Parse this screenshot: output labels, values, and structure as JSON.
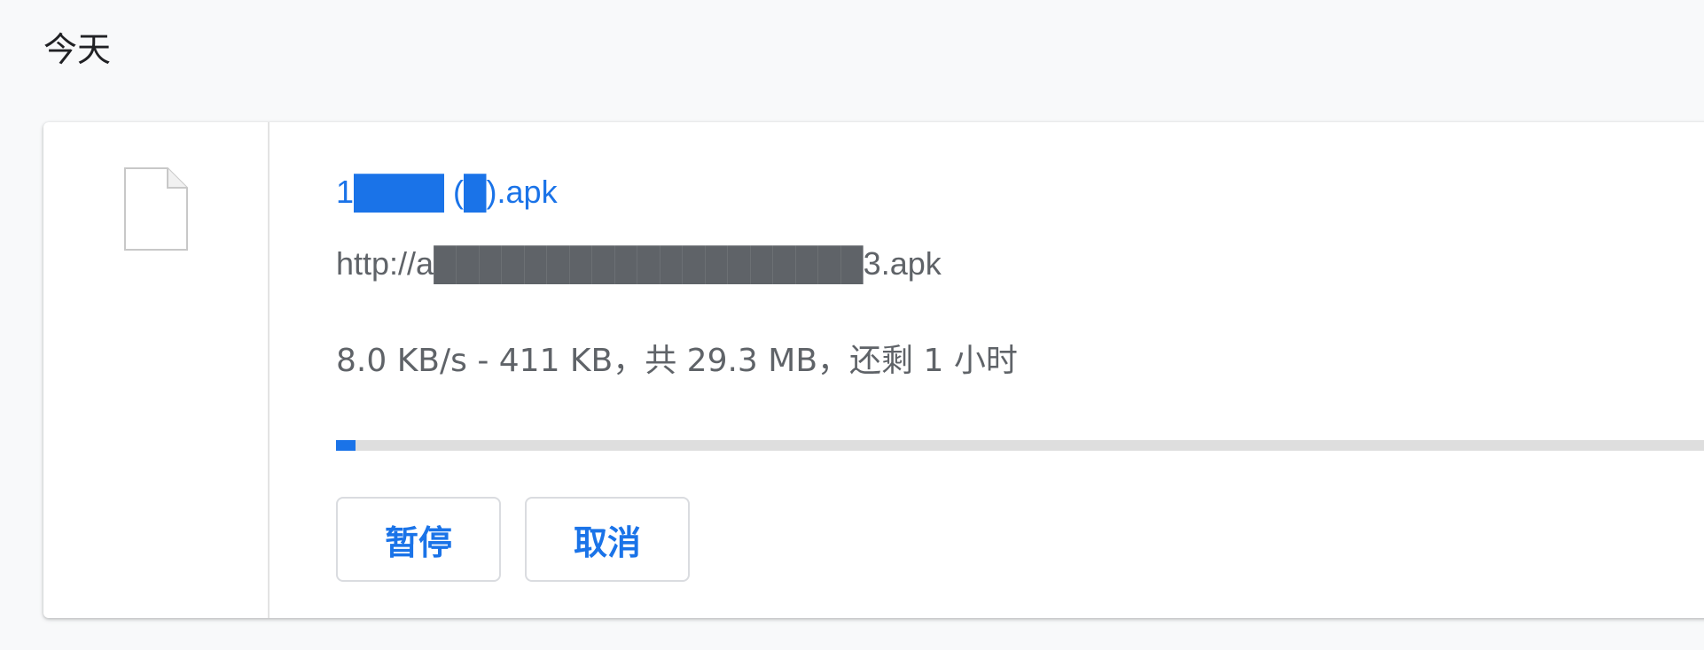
{
  "section": {
    "title": "今天"
  },
  "download": {
    "file_name": "1████ (█).apk",
    "url": "http://a███████████████████3.apk",
    "status": "8.0 KB/s - 411 KB，共 29.3 MB，还剩 1 小时",
    "progress_fraction": 0.014,
    "icon": "file-icon"
  },
  "buttons": {
    "pause_label": "暂停",
    "cancel_label": "取消"
  },
  "colors": {
    "accent": "#1a73e8",
    "secondary_text": "#5f6368",
    "track": "#dedede"
  }
}
